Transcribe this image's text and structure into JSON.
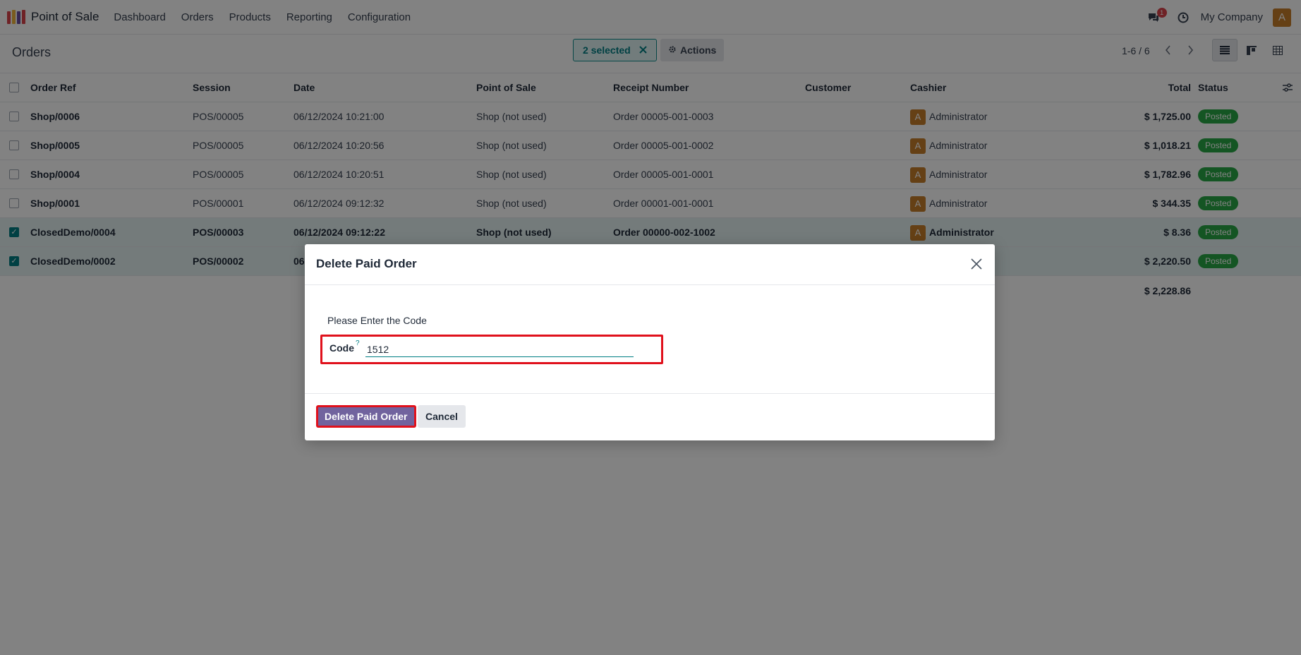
{
  "navbar": {
    "app_name": "Point of Sale",
    "menu": [
      "Dashboard",
      "Orders",
      "Products",
      "Reporting",
      "Configuration"
    ],
    "messages_badge": "1",
    "company": "My Company",
    "user_initial": "A"
  },
  "control": {
    "title": "Orders",
    "selected_label": "2 selected",
    "actions_label": "Actions",
    "pager": "1-6 / 6"
  },
  "table": {
    "headers": [
      "Order Ref",
      "Session",
      "Date",
      "Point of Sale",
      "Receipt Number",
      "Customer",
      "Cashier",
      "Total",
      "Status"
    ],
    "rows": [
      {
        "ref": "Shop/0006",
        "session": "POS/00005",
        "date": "06/12/2024 10:21:00",
        "pos": "Shop (not used)",
        "receipt": "Order 00005-001-0003",
        "customer": "",
        "cashier_initial": "A",
        "cashier": "Administrator",
        "total": "$ 1,725.00",
        "status": "Posted",
        "selected": false
      },
      {
        "ref": "Shop/0005",
        "session": "POS/00005",
        "date": "06/12/2024 10:20:56",
        "pos": "Shop (not used)",
        "receipt": "Order 00005-001-0002",
        "customer": "",
        "cashier_initial": "A",
        "cashier": "Administrator",
        "total": "$ 1,018.21",
        "status": "Posted",
        "selected": false
      },
      {
        "ref": "Shop/0004",
        "session": "POS/00005",
        "date": "06/12/2024 10:20:51",
        "pos": "Shop (not used)",
        "receipt": "Order 00005-001-0001",
        "customer": "",
        "cashier_initial": "A",
        "cashier": "Administrator",
        "total": "$ 1,782.96",
        "status": "Posted",
        "selected": false
      },
      {
        "ref": "Shop/0001",
        "session": "POS/00001",
        "date": "06/12/2024 09:12:32",
        "pos": "Shop (not used)",
        "receipt": "Order 00001-001-0001",
        "customer": "",
        "cashier_initial": "A",
        "cashier": "Administrator",
        "total": "$ 344.35",
        "status": "Posted",
        "selected": false
      },
      {
        "ref": "ClosedDemo/0004",
        "session": "POS/00003",
        "date": "06/12/2024 09:12:22",
        "pos": "Shop (not used)",
        "receipt": "Order 00000-002-1002",
        "customer": "",
        "cashier_initial": "A",
        "cashier": "Administrator",
        "total": "$ 8.36",
        "status": "Posted",
        "selected": true
      },
      {
        "ref": "ClosedDemo/0002",
        "session": "POS/00002",
        "date": "06",
        "pos": "",
        "receipt": "",
        "customer": "",
        "cashier_initial": "",
        "cashier": "",
        "total": "$ 2,220.50",
        "status": "Posted",
        "selected": true
      }
    ],
    "sum_total": "$ 2,228.86"
  },
  "modal": {
    "title": "Delete Paid Order",
    "instruction": "Please Enter the Code",
    "code_label": "Code",
    "code_help": "?",
    "code_value": "1512",
    "delete_label": "Delete Paid Order",
    "cancel_label": "Cancel"
  },
  "colors": {
    "accent": "#017e84",
    "primary_button": "#71639e",
    "highlight": "#e0111c",
    "status_posted": "#28a745"
  }
}
